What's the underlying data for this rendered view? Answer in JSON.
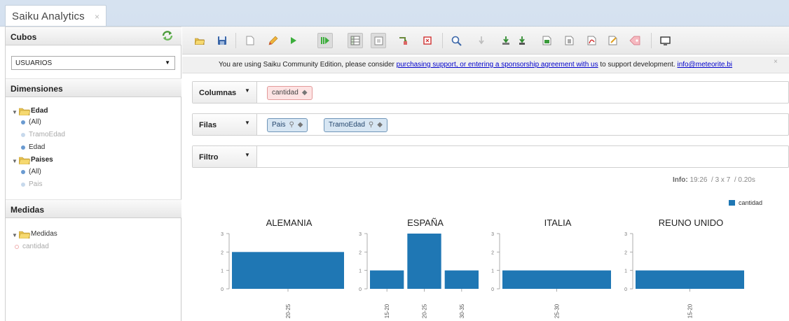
{
  "browser": {
    "tab_title": "Saiku Analytics",
    "tab_close": "×"
  },
  "sidebar": {
    "cubes_header": "Cubos",
    "cube_selected": "USUARIOS",
    "dimensions_header": "Dimensiones",
    "dimensions": [
      {
        "folder": "Edad",
        "items": [
          {
            "label": "(All)",
            "dim": false
          },
          {
            "label": "TramoEdad",
            "dim": true
          },
          {
            "label": "Edad",
            "dim": false
          }
        ]
      },
      {
        "folder": "Paises",
        "items": [
          {
            "label": "(All)",
            "dim": false
          },
          {
            "label": "Pais",
            "dim": true
          }
        ]
      }
    ],
    "measures_header": "Medidas",
    "measures_folder": "Medidas",
    "measures": [
      "cantidad"
    ]
  },
  "toolbar": {
    "icons": [
      "folder-icon",
      "save-icon",
      "new-query-icon",
      "edit-icon",
      "run-icon",
      "auto-run-icon",
      "toggle-fields-icon",
      "toggle-sidebar-icon",
      "hide-parents-icon",
      "non-empty-icon",
      "swap-axis-icon",
      "show-mdx-icon",
      "explain-icon",
      "drillthrough-icon",
      "export-csv-icon",
      "export-xls-icon",
      "export-excel-icon",
      "export-pdf-icon",
      "query-ops-icon",
      "tag-icon",
      "chart-mode-icon"
    ]
  },
  "notice": {
    "prefix": "You are using Saiku Community Edition, please consider ",
    "link": "purchasing support, or entering a sponsorship agreement with us",
    "middle": " to support development. ",
    "email": "info@meteorite.bi",
    "close": "×"
  },
  "axes": {
    "columns_label": "Columnas",
    "rows_label": "Filas",
    "filter_label": "Filtro",
    "columns_pills": [
      "cantidad"
    ],
    "rows_pills": [
      "Pais",
      "TramoEdad"
    ]
  },
  "info": {
    "label": "Info:",
    "time": "19:26",
    "dims": "3 x 7",
    "duration": "0.20s"
  },
  "colors": {
    "bar": "#1f77b4",
    "measure_pill": "#fde3e3",
    "level_pill": "#d7e6f3",
    "link": "#0000cc"
  },
  "chart_data": {
    "type": "bar",
    "legend": "cantidad",
    "legend_position": "top-right",
    "ylim": [
      0,
      3
    ],
    "yticks": [
      0,
      1,
      2,
      3
    ],
    "panels": [
      {
        "title": "ALEMANIA",
        "categories": [
          "20-25"
        ],
        "values": [
          2
        ]
      },
      {
        "title": "ESPAÑA",
        "categories": [
          "15-20",
          "20-25",
          "30-35"
        ],
        "values": [
          1,
          3,
          1
        ]
      },
      {
        "title": "ITALIA",
        "categories": [
          "25-30"
        ],
        "values": [
          1
        ]
      },
      {
        "title": "REUNO UNIDO",
        "categories": [
          "15-20"
        ],
        "values": [
          1
        ]
      }
    ]
  }
}
